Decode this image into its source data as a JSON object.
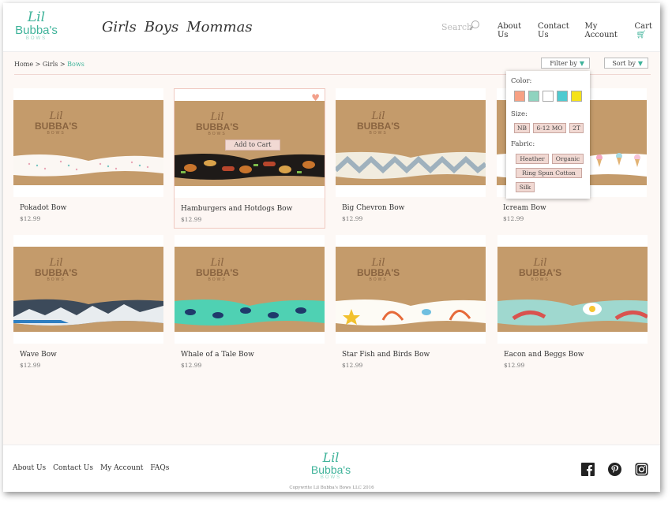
{
  "brand": {
    "logo_line1": "Lil",
    "logo_line2": "Bubba's",
    "logo_line3": "BOWS"
  },
  "main_nav": [
    "Girls",
    "Boys",
    "Mommas"
  ],
  "search": {
    "placeholder": "Search"
  },
  "top_nav": {
    "about": "About Us",
    "contact": "Contact Us",
    "account": "My Account",
    "cart": "Cart"
  },
  "breadcrumb": {
    "home": "Home",
    "sep": ">",
    "girls": "Girls",
    "current": "Bows"
  },
  "toolbar": {
    "filter_label": "Filter by",
    "sort_label": "Sort by"
  },
  "filter": {
    "color_label": "Color:",
    "colors": [
      "#f7a184",
      "#8fd3bf",
      "#ffffff",
      "#4ecad0",
      "#f5e218"
    ],
    "size_label": "Size:",
    "sizes": [
      "NB",
      "6-12 MO",
      "2T"
    ],
    "fabric_label": "Fabric:",
    "fabrics": [
      "Heather",
      "Organic",
      "Ring Spun Cotton",
      "Silk"
    ]
  },
  "products": [
    {
      "name": "Pokadot Bow",
      "price": "$12.99"
    },
    {
      "name": "Hamburgers and Hotdogs Bow",
      "price": "$12.99",
      "add_to_cart": "Add to Cart"
    },
    {
      "name": "Big Chevron Bow",
      "price": "$12.99"
    },
    {
      "name": "Icream Bow",
      "price": "$12.99"
    },
    {
      "name": "Wave Bow",
      "price": "$12.99"
    },
    {
      "name": "Whale of a Tale Bow",
      "price": "$12.99"
    },
    {
      "name": "Star Fish and Birds Bow",
      "price": "$12.99"
    },
    {
      "name": "Eacon and Beggs Bow",
      "price": "$12.99"
    }
  ],
  "card_brand": {
    "b1": "Lil",
    "b2": "BUBBA'S",
    "b3": "BOWS"
  },
  "footer": {
    "about": "About Us",
    "contact": "Contact Us",
    "account": "My Account",
    "faqs": "FAQs",
    "copyright": "Copywrite Lil Bubba's Bows LLC 2016"
  },
  "icons": {
    "search": "search-icon",
    "cart": "cart-icon",
    "heart": "heart-icon",
    "facebook": "facebook-icon",
    "pinterest": "pinterest-icon",
    "instagram": "instagram-icon"
  }
}
